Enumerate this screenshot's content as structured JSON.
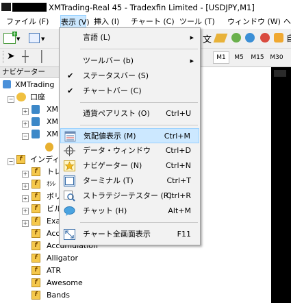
{
  "window": {
    "title": "XMTrading-Real 45 - Tradexfin Limited - [USDJPY,M1]"
  },
  "menubar": [
    {
      "label": "ファイル (F)"
    },
    {
      "label": "表示 (V)"
    },
    {
      "label": "挿入 (I)"
    },
    {
      "label": "チャート (C)"
    },
    {
      "label": "ツール (T)"
    },
    {
      "label": "ウィンドウ (W)"
    },
    {
      "label": "ヘ"
    }
  ],
  "toolbar": {
    "text_fragment": "文",
    "text_fragment2": "自",
    "timeframes": [
      "M1",
      "M5",
      "M15",
      "M30"
    ]
  },
  "navigator": {
    "header": "ナビゲーター",
    "root": "XMTrading",
    "accounts_label": "口座",
    "account_prefix": "XM",
    "indicators_label": "インディケ",
    "items": [
      "トレ",
      "ｵｼﾚ",
      "ボリ",
      "ビル",
      "Exa",
      "Acc",
      "Accumulation",
      "Alligator",
      "ATR",
      "Awesome",
      "Bands"
    ]
  },
  "view_menu": {
    "items": [
      {
        "label": "言語 (L)",
        "shortcut": "",
        "submenu": true
      },
      {
        "label": "ツールバー (b)",
        "shortcut": "",
        "submenu": true
      },
      {
        "label": "ステータスバー (S)",
        "shortcut": "",
        "checked": true
      },
      {
        "label": "チャートバー (C)",
        "shortcut": "",
        "checked": true
      },
      {
        "label": "通貨ペアリスト (O)",
        "shortcut": "Ctrl+U"
      },
      {
        "label": "気配値表示 (M)",
        "shortcut": "Ctrl+M",
        "highlighted": true
      },
      {
        "label": "データ・ウィンドウ",
        "shortcut": "Ctrl+D"
      },
      {
        "label": "ナビゲーター (N)",
        "shortcut": "Ctrl+N"
      },
      {
        "label": "ターミナル (T)",
        "shortcut": "Ctrl+T"
      },
      {
        "label": "ストラテジーテスター (R)",
        "shortcut": "Ctrl+R"
      },
      {
        "label": "チャット (H)",
        "shortcut": "Alt+M"
      },
      {
        "label": "チャート全画面表示",
        "shortcut": "F11"
      }
    ],
    "check_mark": "✔",
    "submenu_arrow": "▶"
  },
  "colors": {
    "highlight": "#cce8ff",
    "highlight_border": "#99d1ff",
    "chart_bg": "#000000",
    "indicator_icon": "#f5c84c"
  }
}
